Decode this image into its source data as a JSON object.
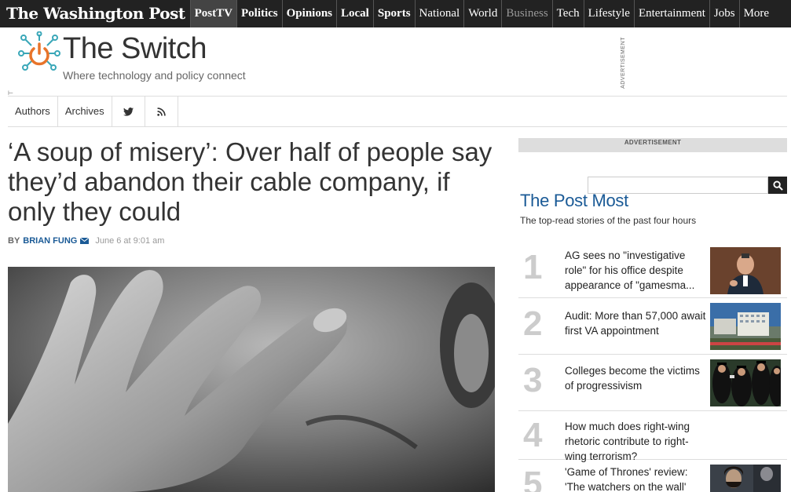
{
  "masthead": {
    "logo": "The Washington Post",
    "nav": [
      "PostTV",
      "Politics",
      "Opinions",
      "Local",
      "Sports",
      "National",
      "World",
      "Business",
      "Tech",
      "Lifestyle",
      "Entertainment",
      "Jobs",
      "More"
    ]
  },
  "blog": {
    "title": "The Switch",
    "tagline": "Where technology and policy connect",
    "advertisement_vertical": "ADVERTISEMENT"
  },
  "subnav": {
    "authors": "Authors",
    "archives": "Archives",
    "twitter_icon": "twitter-icon",
    "rss_icon": "rss-icon"
  },
  "article": {
    "headline": "‘A soup of misery’: Over half of people say they’d abandon their cable company, if only they could",
    "by": "BY",
    "author": "BRIAN FUNG",
    "date": "June 6 at 9:01 am"
  },
  "sidebar": {
    "ad_label": "ADVERTISEMENT",
    "search_placeholder": "",
    "post_most_title": "The Post Most",
    "post_most_sub": "The top-read stories of the past four hours",
    "items": [
      {
        "rank": "1",
        "title": "AG sees no \"investigative role\" for his office despite appearance of \"gamesma..."
      },
      {
        "rank": "2",
        "title": "Audit: More than 57,000 await first VA appointment"
      },
      {
        "rank": "3",
        "title": "Colleges become the victims of progressivism"
      },
      {
        "rank": "4",
        "title": "How much does right-wing rhetoric contribute to right-wing terrorism?"
      },
      {
        "rank": "5",
        "title": "'Game of Thrones' review: 'The watchers on the wall'"
      }
    ]
  },
  "colors": {
    "nav_bg": "#222222",
    "link_blue": "#1a5a96",
    "logo_orange": "#e8742a",
    "logo_teal": "#3aa7b8"
  }
}
